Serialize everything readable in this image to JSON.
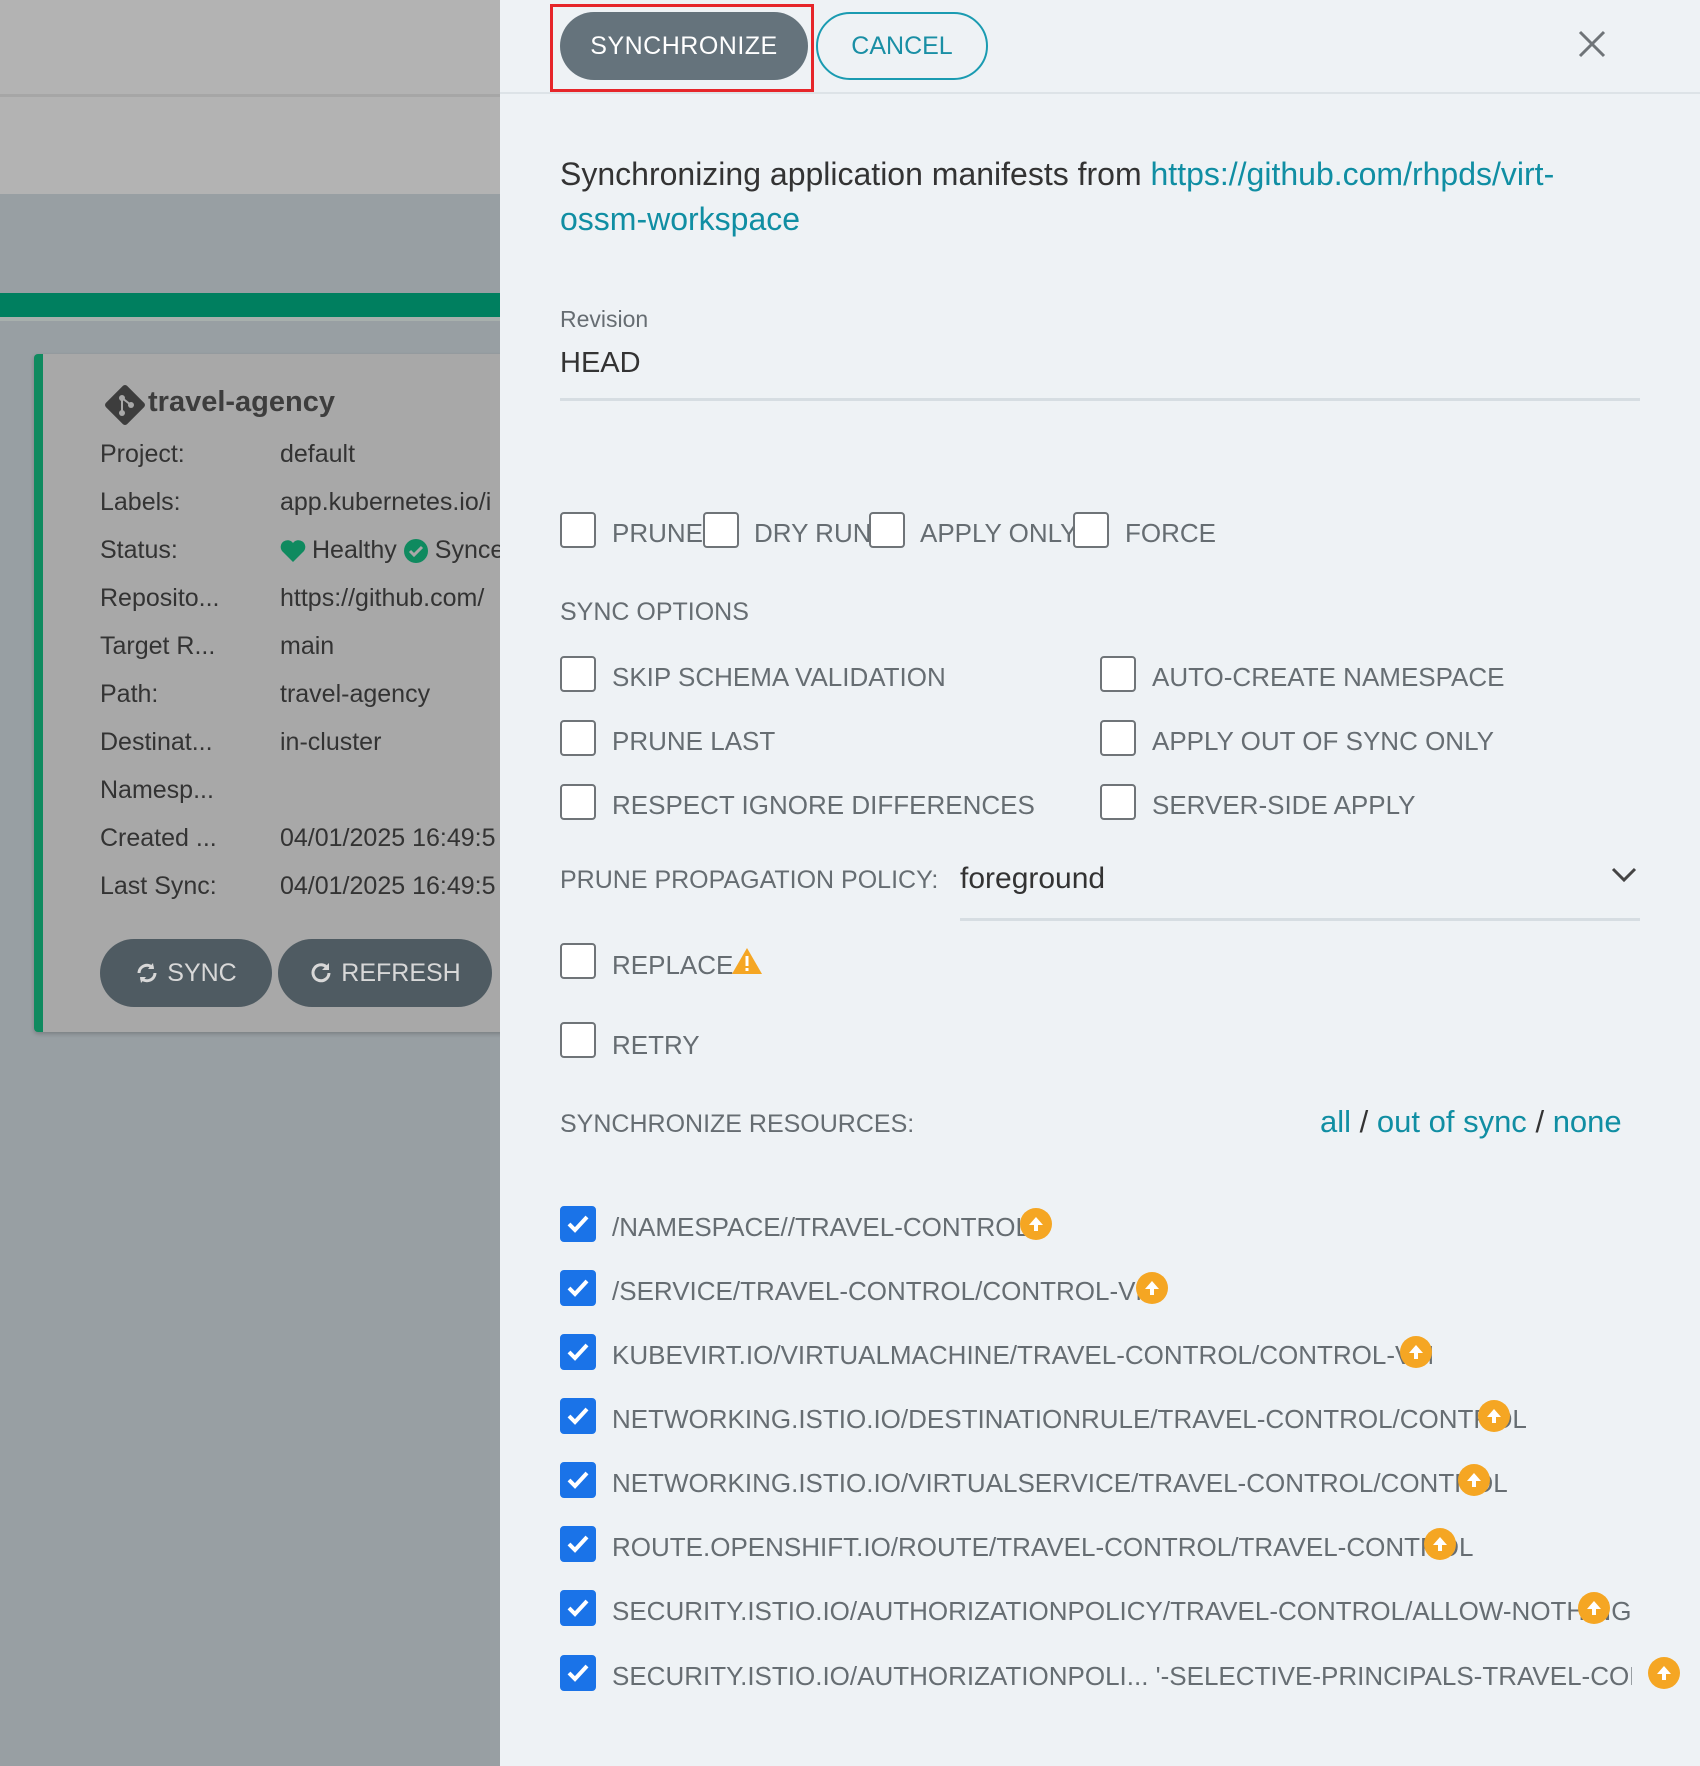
{
  "card": {
    "title": "travel-agency",
    "rows": [
      {
        "label": "Project:",
        "value": "default"
      },
      {
        "label": "Labels:",
        "value": "app.kubernetes.io/i"
      },
      {
        "label": "Status:",
        "value_healthy": "Healthy",
        "value_sync": "Synce"
      },
      {
        "label": "Reposito...",
        "value": "https://github.com/"
      },
      {
        "label": "Target R...",
        "value": "main"
      },
      {
        "label": "Path:",
        "value": "travel-agency"
      },
      {
        "label": "Destinat...",
        "value": "in-cluster"
      },
      {
        "label": "Namesp...",
        "value": ""
      },
      {
        "label": "Created ...",
        "value": "04/01/2025 16:49:5"
      },
      {
        "label": "Last Sync:",
        "value": "04/01/2025 16:49:5"
      }
    ],
    "sync_label": "SYNC",
    "refresh_label": "REFRESH"
  },
  "panel": {
    "synchronize_label": "SYNCHRONIZE",
    "cancel_label": "CANCEL",
    "intro_text": "Synchronizing application manifests from ",
    "repo_url_line1": "https://github.com/rhpds/virt-",
    "repo_url_line2": "ossm-workspace",
    "revision_label": "Revision",
    "revision_value": "HEAD",
    "top_options": [
      "PRUNE",
      "DRY RUN",
      "APPLY ONLY",
      "FORCE"
    ],
    "sync_options_title": "SYNC OPTIONS",
    "sync_options": [
      "SKIP SCHEMA VALIDATION",
      "AUTO-CREATE NAMESPACE",
      "PRUNE LAST",
      "APPLY OUT OF SYNC ONLY",
      "RESPECT IGNORE DIFFERENCES",
      "SERVER-SIDE APPLY"
    ],
    "prune_policy_label": "PRUNE PROPAGATION POLICY:",
    "prune_policy_value": "foreground",
    "replace_label": "REPLACE",
    "retry_label": "RETRY",
    "sync_resources_label": "SYNCHRONIZE RESOURCES:",
    "filter_all": "all",
    "filter_sep": "/",
    "filter_out_of_sync": "out of sync",
    "filter_none": "none",
    "resources": [
      "/NAMESPACE//TRAVEL-CONTROL",
      "/SERVICE/TRAVEL-CONTROL/CONTROL-VM",
      "KUBEVIRT.IO/VIRTUALMACHINE/TRAVEL-CONTROL/CONTROL-VM",
      "NETWORKING.ISTIO.IO/DESTINATIONRULE/TRAVEL-CONTROL/CONTROL",
      "NETWORKING.ISTIO.IO/VIRTUALSERVICE/TRAVEL-CONTROL/CONTROL",
      "ROUTE.OPENSHIFT.IO/ROUTE/TRAVEL-CONTROL/TRAVEL-CONTROL",
      "SECURITY.ISTIO.IO/AUTHORIZATIONPOLICY/TRAVEL-CONTROL/ALLOW-NOTHING",
      "SECURITY.ISTIO.IO/AUTHORIZATIONPOLI... '-SELECTIVE-PRINCIPALS-TRAVEL-CONTROL"
    ]
  },
  "colors": {
    "accent": "#108ea3",
    "checked": "#1a73e8",
    "warning": "#f5a623",
    "healthy": "#0f8a5f",
    "highlight": "#e6262a"
  }
}
